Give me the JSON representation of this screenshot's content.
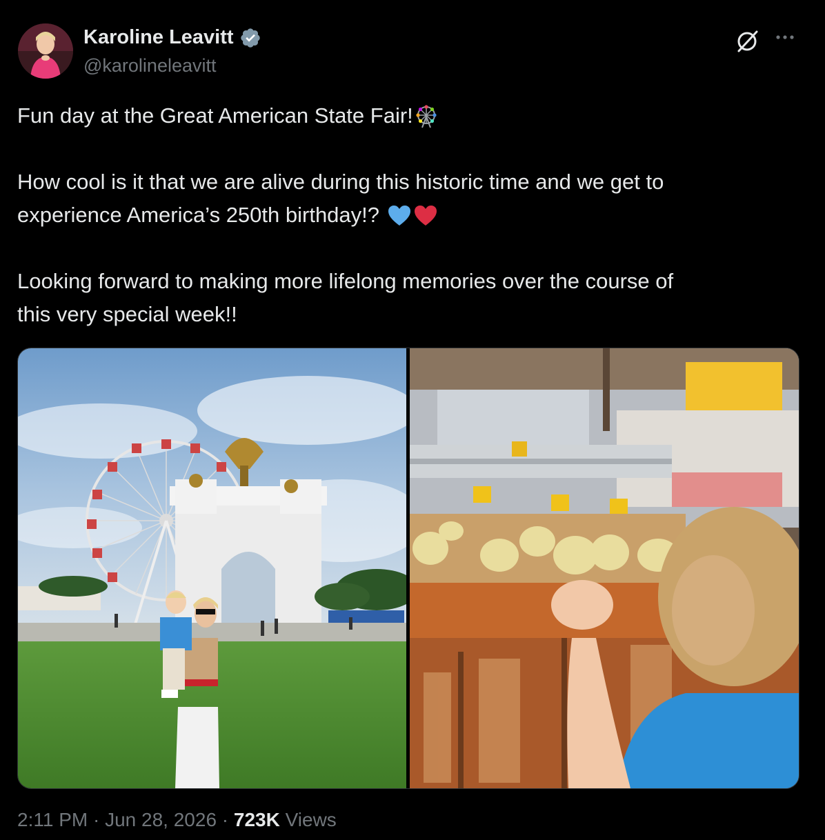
{
  "author": {
    "name": "Karoline Leavitt",
    "handle": "@karolineleavitt",
    "verified": true,
    "verified_color": "#829aab"
  },
  "tweet": {
    "line1": "Fun day at the Great American State Fair!",
    "line1_emoji": "ferris-wheel",
    "para2": "How cool is it that we are alive during this historic time and we get to\nexperience America’s 250th birthday!? ",
    "para2_emojis": [
      "blue-heart",
      "red-heart"
    ],
    "para3": "Looking forward to making more lifelong memories over the course of\nthis very special week!!"
  },
  "media": [
    {
      "description_icon": "photo-fairground"
    },
    {
      "description_icon": "photo-chicks"
    }
  ],
  "meta": {
    "time": "2:11 PM",
    "separator": " · ",
    "date": "Jun 28, 2026",
    "views_count": "723K",
    "views_label": " Views"
  },
  "colors": {
    "background": "#000000",
    "text": "#e7e9ea",
    "secondary": "#71767b",
    "border": "#2f3336"
  }
}
